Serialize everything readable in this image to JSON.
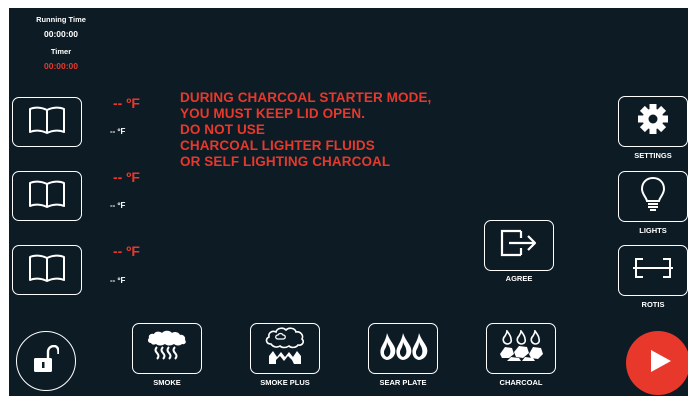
{
  "status": {
    "running_time_label": "Running Time",
    "running_time_value": "00:00:00",
    "timer_label": "Timer",
    "timer_value": "00:00:00"
  },
  "probes": [
    {
      "set_temp": "-- ºF",
      "actual_temp": "-- ºF"
    },
    {
      "set_temp": "-- ºF",
      "actual_temp": "-- ºF"
    },
    {
      "set_temp": "-- ºF",
      "actual_temp": "-- ºF"
    }
  ],
  "warning": {
    "lines": [
      "DURING CHARCOAL STARTER MODE,",
      "YOU MUST KEEP LID OPEN.",
      "DO NOT USE",
      "CHARCOAL LIGHTER FLUIDS",
      "OR SELF LIGHTING CHARCOAL"
    ]
  },
  "right_menu": {
    "settings_label": "SETTINGS",
    "lights_label": "LIGHTS",
    "rotis_label": "ROTIS"
  },
  "agree_label": "AGREE",
  "modes": [
    {
      "label": "SMOKE",
      "icon": "smoke-icon"
    },
    {
      "label": "SMOKE PLUS",
      "icon": "smoke-plus-icon"
    },
    {
      "label": "SEAR PLATE",
      "icon": "flames-icon"
    },
    {
      "label": "CHARCOAL",
      "icon": "charcoal-icon"
    }
  ],
  "colors": {
    "background": "#0d1b24",
    "accent_red": "#e8382b",
    "foreground": "#ffffff"
  }
}
